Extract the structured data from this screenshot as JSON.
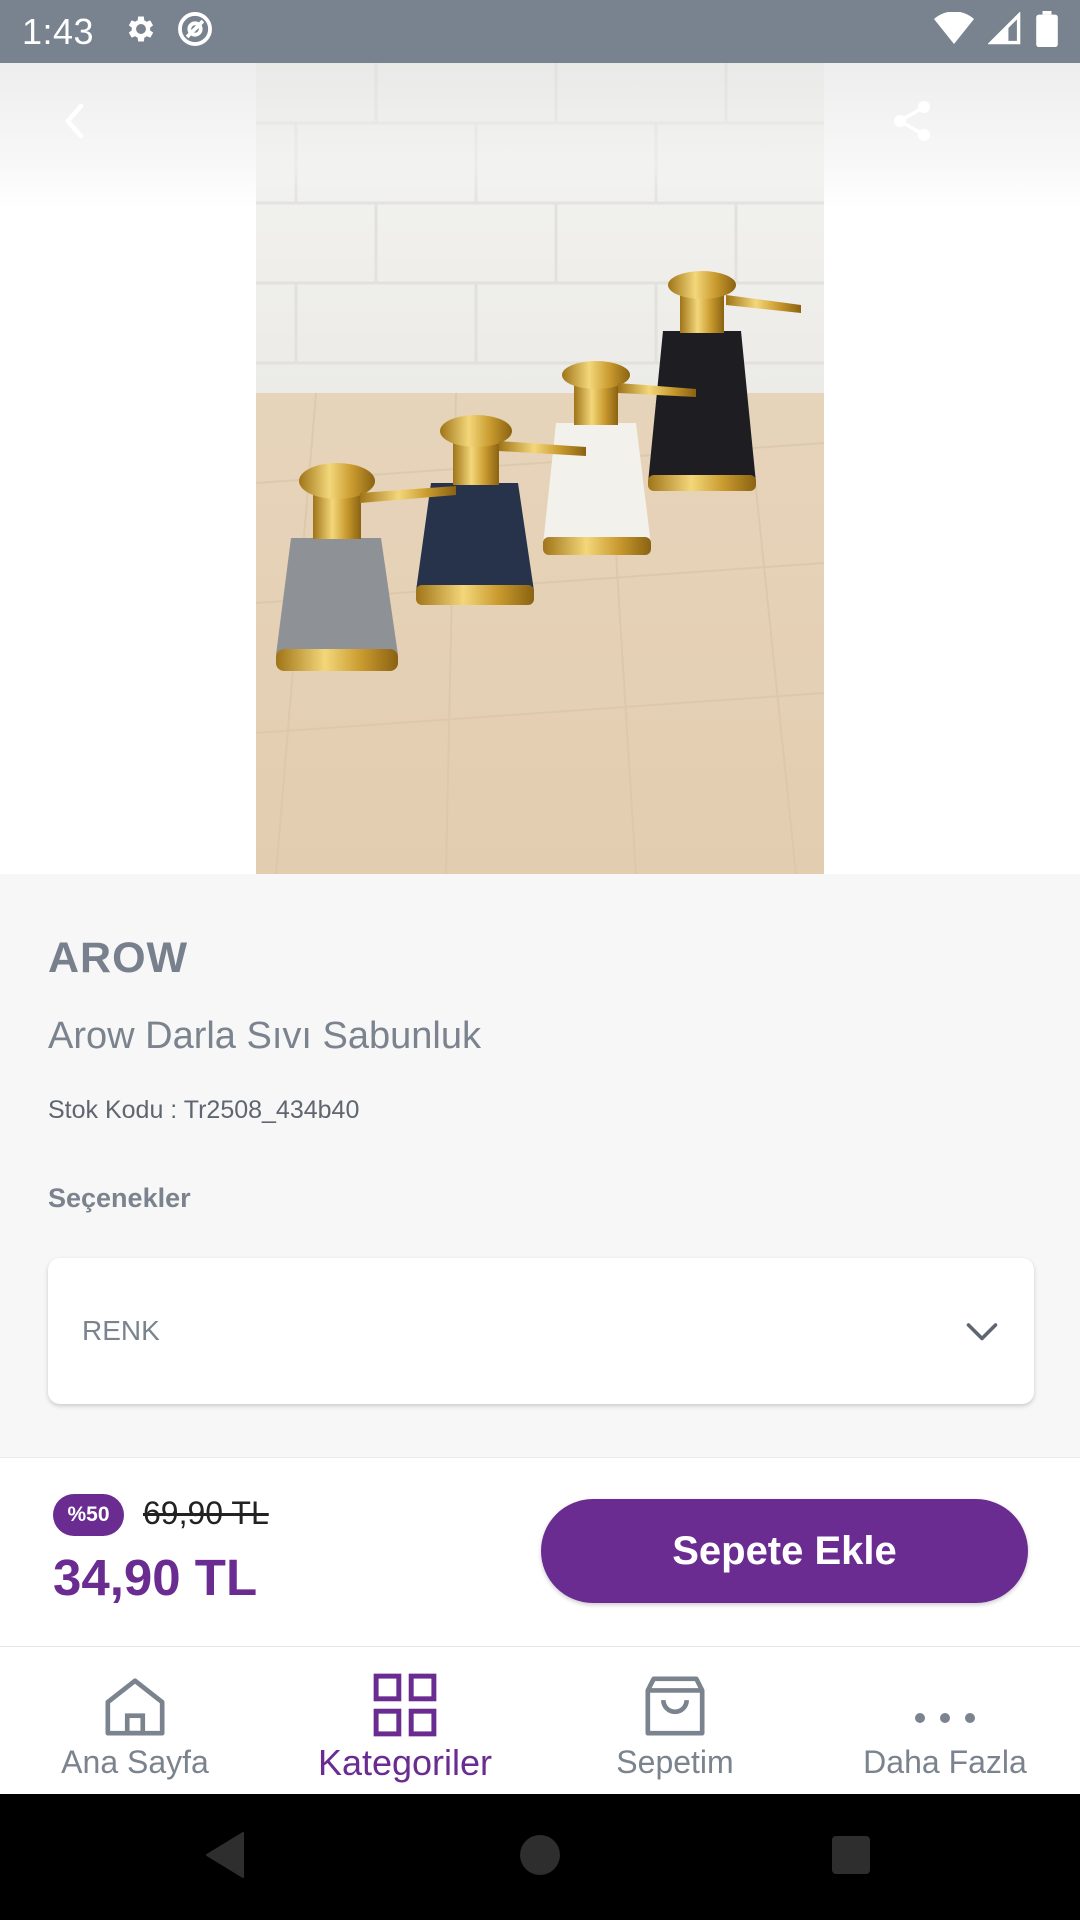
{
  "status_bar": {
    "time": "1:43"
  },
  "header": {
    "back_icon": "chevron-left-icon",
    "share_icon": "share-icon"
  },
  "product": {
    "brand": "AROW",
    "name": "Arow Darla Sıvı Sabunluk",
    "sku": "Stok Kodu : Tr2508_434b40",
    "options_label": "Seçenekler",
    "option_select": {
      "value": "RENK"
    }
  },
  "price": {
    "discount_badge": "%50",
    "old_price": "69,90 TL",
    "new_price": "34,90 TL",
    "add_to_cart_label": "Sepete Ekle"
  },
  "bottom_nav": {
    "items": [
      {
        "label": "Ana Sayfa",
        "icon": "home-icon",
        "active": false
      },
      {
        "label": "Kategoriler",
        "icon": "grid-icon",
        "active": true
      },
      {
        "label": "Sepetim",
        "icon": "shopping-bag-icon",
        "active": false
      },
      {
        "label": "Daha Fazla",
        "icon": "more-icon",
        "active": false
      }
    ]
  },
  "colors": {
    "accent": "#6a2c91",
    "text_muted": "#7b838e",
    "status_bar": "#78838f"
  }
}
